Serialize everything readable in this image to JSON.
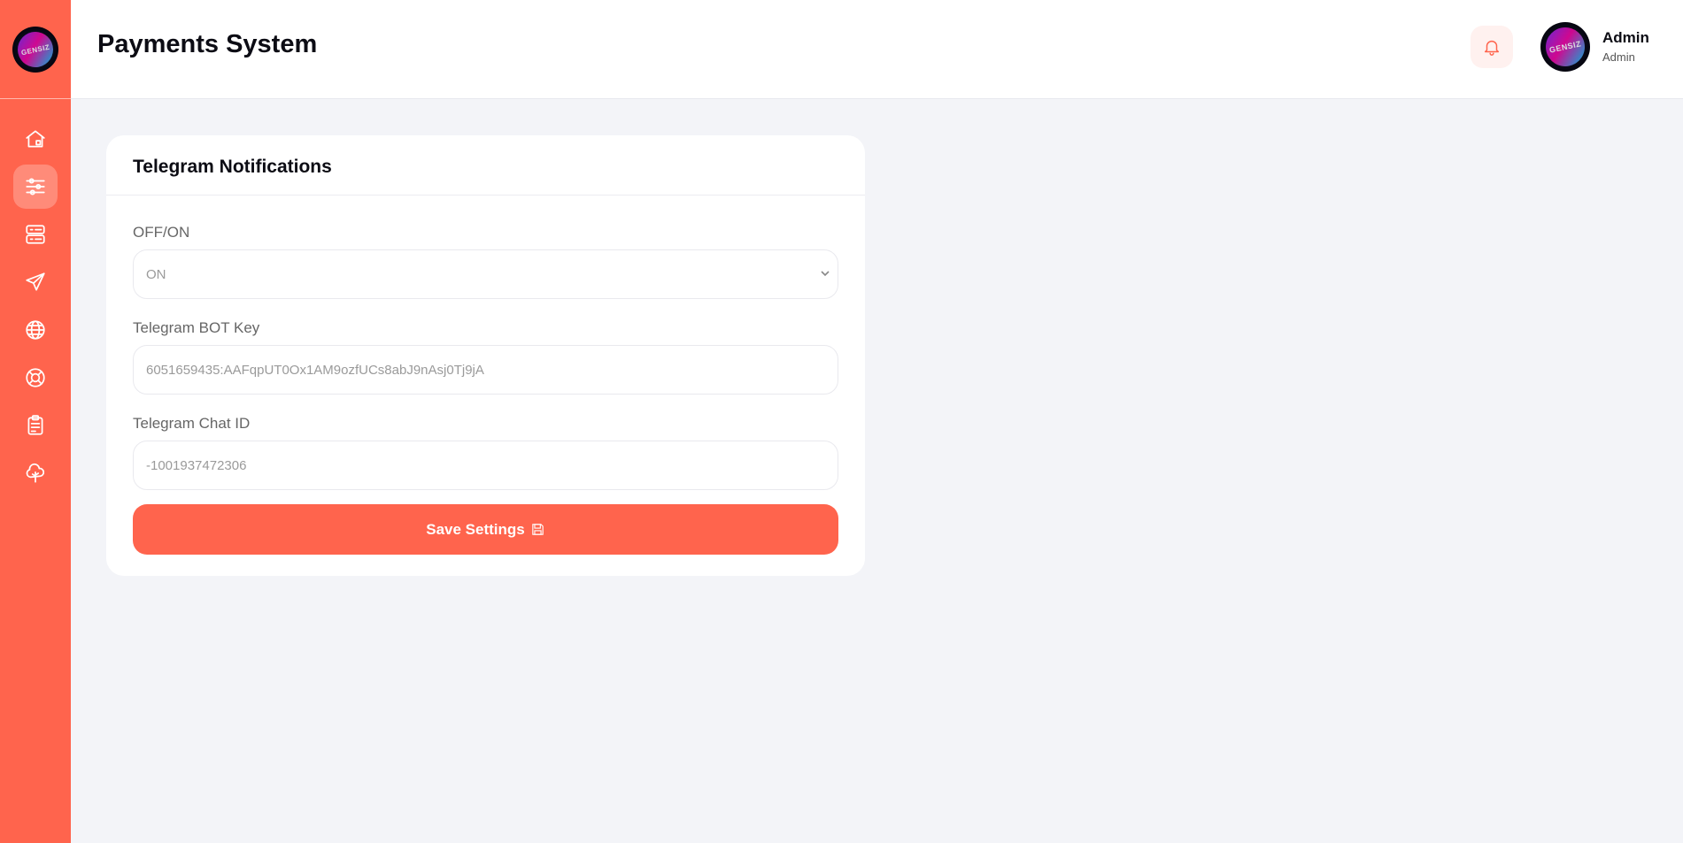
{
  "header": {
    "title": "Payments System",
    "user": {
      "name": "Admin",
      "role": "Admin"
    }
  },
  "sidebar": {
    "items": [
      {
        "icon": "home-icon"
      },
      {
        "icon": "sliders-icon",
        "active": true
      },
      {
        "icon": "server-icon"
      },
      {
        "icon": "send-icon"
      },
      {
        "icon": "globe-icon"
      },
      {
        "icon": "lifebuoy-icon"
      },
      {
        "icon": "clipboard-icon"
      },
      {
        "icon": "tree-icon"
      }
    ]
  },
  "card": {
    "title": "Telegram Notifications",
    "fields": [
      {
        "label": "OFF/ON",
        "value": "ON"
      },
      {
        "label": "Telegram BOT Key",
        "value": "6051659435:AAFqpUT0Ox1AM9ozfUCs8abJ9nAsj0Tj9jA"
      },
      {
        "label": "Telegram Chat ID",
        "value": "-1001937472306"
      }
    ],
    "save_label": "Save Settings"
  },
  "colors": {
    "accent": "#ff644d",
    "background": "#f3f4f8"
  }
}
